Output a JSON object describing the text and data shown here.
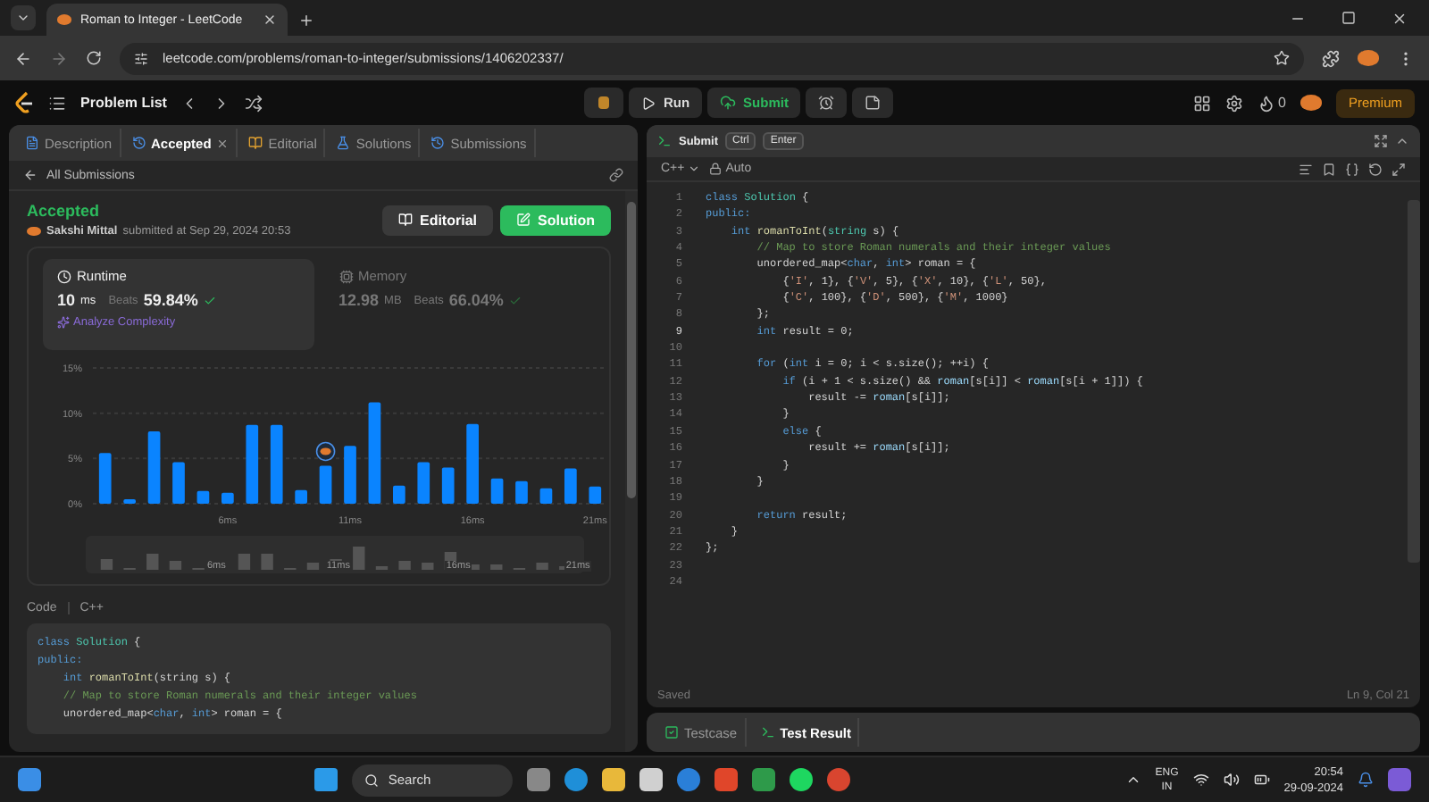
{
  "browser": {
    "tab_title": "Roman to Integer - LeetCode",
    "url": "leetcode.com/problems/roman-to-integer/submissions/1406202337/"
  },
  "topbar": {
    "problem_list": "Problem List",
    "run": "Run",
    "submit": "Submit",
    "streak": "0",
    "premium": "Premium"
  },
  "left_tabs": [
    {
      "label": "Description",
      "selected": false,
      "kind": "description"
    },
    {
      "label": "Accepted",
      "selected": true,
      "kind": "accepted"
    },
    {
      "label": "Editorial",
      "selected": false,
      "kind": "editorial"
    },
    {
      "label": "Solutions",
      "selected": false,
      "kind": "solutions"
    },
    {
      "label": "Submissions",
      "selected": false,
      "kind": "submissions"
    }
  ],
  "back_link": "All Submissions",
  "submission": {
    "status": "Accepted",
    "user": "Sakshi Mittal",
    "submitted": "submitted at Sep 29, 2024 20:53",
    "editorial_button": "Editorial",
    "solution_button": "Solution"
  },
  "metrics": [
    {
      "kind": "runtime",
      "title": "Runtime",
      "value": "10",
      "unit": "ms",
      "beats_label": "Beats",
      "beats": "59.84%",
      "selected": true,
      "link": "Analyze Complexity"
    },
    {
      "kind": "memory",
      "title": "Memory",
      "value": "12.98",
      "unit": "MB",
      "beats_label": "Beats",
      "beats": "66.04%",
      "selected": false
    }
  ],
  "chart_data": {
    "type": "bar",
    "x": [
      1,
      2,
      3,
      4,
      5,
      6,
      7,
      8,
      9,
      10,
      11,
      12,
      13,
      14,
      15,
      16,
      17,
      18,
      19,
      20,
      21
    ],
    "xlim": [
      0.5,
      21.5
    ],
    "series": [
      {
        "color": "#0a84ff",
        "values": [
          5.6,
          0.5,
          8,
          4.6,
          1.4,
          1.2,
          8.7,
          8.7,
          1.5,
          4.2,
          6.4,
          11.2,
          2,
          4.6,
          4,
          8.8,
          2.8,
          2.5,
          1.7,
          3.9,
          1.9
        ]
      }
    ],
    "ylim": [
      0,
      15
    ],
    "yticks": [
      {
        "value": 0,
        "label": "0%"
      },
      {
        "value": 5,
        "label": "5%"
      },
      {
        "value": 10,
        "label": "10%"
      },
      {
        "value": 15,
        "label": "15%"
      }
    ],
    "xticks": [
      {
        "value": 6,
        "label": "6ms"
      },
      {
        "value": 11,
        "label": "11ms"
      },
      {
        "value": 16,
        "label": "16ms"
      },
      {
        "value": 21,
        "label": "21ms"
      }
    ]
  },
  "runtime_marker": {
    "level": 0.4524
  },
  "overview_labels": [
    "6ms",
    "11ms",
    "16ms",
    "21ms"
  ],
  "code_header": {
    "title": "Code",
    "language": "C++"
  },
  "left_code": [
    [
      {
        "text": "class ",
        "kind": "keyword"
      },
      {
        "text": "Solution",
        "kind": "type"
      },
      {
        "text": " {",
        "kind": "plain"
      }
    ],
    [
      {
        "text": "public:",
        "kind": "keyword"
      }
    ],
    [
      {
        "text": "    int ",
        "kind": "keyword"
      },
      {
        "text": "romanToInt",
        "kind": "function"
      },
      {
        "text": "(string s) {",
        "kind": "plain"
      }
    ],
    [
      {
        "text": "    // Map to store Roman numerals and their integer values",
        "kind": "comment"
      }
    ],
    [
      {
        "text": "    unordered_map<",
        "kind": "plain"
      },
      {
        "text": "char",
        "kind": "keyword"
      },
      {
        "text": ", ",
        "kind": "plain"
      },
      {
        "text": "int",
        "kind": "keyword"
      },
      {
        "text": "> roman = {",
        "kind": "plain"
      }
    ]
  ],
  "editor_header": {
    "submit": "Submit",
    "key1": "Ctrl",
    "key2": "Enter",
    "language": "C++",
    "mode": "Auto"
  },
  "editor_lines": [
    {
      "n": "1",
      "tokens": [
        {
          "text": "class ",
          "kind": "keyword"
        },
        {
          "text": "Solution",
          "kind": "type"
        },
        {
          "text": " {",
          "kind": "plain"
        }
      ]
    },
    {
      "n": "2",
      "tokens": [
        {
          "text": "public:",
          "kind": "keyword"
        }
      ]
    },
    {
      "n": "3",
      "tokens": [
        {
          "text": "    int ",
          "kind": "keyword"
        },
        {
          "text": "romanToInt",
          "kind": "function"
        },
        {
          "text": "(",
          "kind": "plain"
        },
        {
          "text": "string ",
          "kind": "type"
        },
        {
          "text": "s) {",
          "kind": "plain"
        }
      ]
    },
    {
      "n": "4",
      "tokens": [
        {
          "text": "        // Map to store Roman numerals and their integer values",
          "kind": "comment"
        }
      ]
    },
    {
      "n": "5",
      "tokens": [
        {
          "text": "        unordered_map<",
          "kind": "plain"
        },
        {
          "text": "char",
          "kind": "keyword"
        },
        {
          "text": ", ",
          "kind": "plain"
        },
        {
          "text": "int",
          "kind": "keyword"
        },
        {
          "text": "> roman = {",
          "kind": "plain"
        }
      ]
    },
    {
      "n": "6",
      "tokens": [
        {
          "text": "            {",
          "kind": "plain"
        },
        {
          "text": "'I'",
          "kind": "string"
        },
        {
          "text": ", 1}, {",
          "kind": "plain"
        },
        {
          "text": "'V'",
          "kind": "string"
        },
        {
          "text": ", 5}, {",
          "kind": "plain"
        },
        {
          "text": "'X'",
          "kind": "string"
        },
        {
          "text": ", 10}, {",
          "kind": "plain"
        },
        {
          "text": "'L'",
          "kind": "string"
        },
        {
          "text": ", 50},",
          "kind": "plain"
        }
      ]
    },
    {
      "n": "7",
      "tokens": [
        {
          "text": "            {",
          "kind": "plain"
        },
        {
          "text": "'C'",
          "kind": "string"
        },
        {
          "text": ", 100}, {",
          "kind": "plain"
        },
        {
          "text": "'D'",
          "kind": "string"
        },
        {
          "text": ", 500}, {",
          "kind": "plain"
        },
        {
          "text": "'M'",
          "kind": "string"
        },
        {
          "text": ", 1000}",
          "kind": "plain"
        }
      ]
    },
    {
      "n": "8",
      "tokens": [
        {
          "text": "        };",
          "kind": "plain"
        }
      ]
    },
    {
      "n": "9",
      "tokens": [
        {
          "text": "        int ",
          "kind": "keyword"
        },
        {
          "text": "result = 0;",
          "kind": "plain"
        }
      ]
    },
    {
      "n": "10"
    },
    {
      "n": "11",
      "tokens": [
        {
          "text": "        for ",
          "kind": "keyword"
        },
        {
          "text": "(",
          "kind": "plain"
        },
        {
          "text": "int ",
          "kind": "keyword"
        },
        {
          "text": "i = 0; i < s.size(); ++i) {",
          "kind": "plain"
        }
      ]
    },
    {
      "n": "12",
      "tokens": [
        {
          "text": "            if ",
          "kind": "keyword"
        },
        {
          "text": "(i + 1 < s.size() && ",
          "kind": "plain"
        },
        {
          "text": "roman",
          "kind": "variable"
        },
        {
          "text": "[s[i]] < ",
          "kind": "plain"
        },
        {
          "text": "roman",
          "kind": "variable"
        },
        {
          "text": "[s[i + 1]]) {",
          "kind": "plain"
        }
      ]
    },
    {
      "n": "13",
      "tokens": [
        {
          "text": "                result -= ",
          "kind": "plain"
        },
        {
          "text": "roman",
          "kind": "variable"
        },
        {
          "text": "[s[i]];",
          "kind": "plain"
        }
      ]
    },
    {
      "n": "14",
      "tokens": [
        {
          "text": "            }",
          "kind": "plain"
        }
      ]
    },
    {
      "n": "15",
      "tokens": [
        {
          "text": "            else ",
          "kind": "keyword"
        },
        {
          "text": "{",
          "kind": "plain"
        }
      ]
    },
    {
      "n": "16",
      "tokens": [
        {
          "text": "                result += ",
          "kind": "plain"
        },
        {
          "text": "roman",
          "kind": "variable"
        },
        {
          "text": "[s[i]];",
          "kind": "plain"
        }
      ]
    },
    {
      "n": "17",
      "tokens": [
        {
          "text": "            }",
          "kind": "plain"
        }
      ]
    },
    {
      "n": "18",
      "tokens": [
        {
          "text": "        }",
          "kind": "plain"
        }
      ]
    },
    {
      "n": "19"
    },
    {
      "n": "20",
      "tokens": [
        {
          "text": "        return ",
          "kind": "keyword"
        },
        {
          "text": "result;",
          "kind": "plain"
        }
      ]
    },
    {
      "n": "21",
      "tokens": [
        {
          "text": "    }",
          "kind": "plain"
        }
      ]
    },
    {
      "n": "22",
      "tokens": [
        {
          "text": "};",
          "kind": "plain"
        }
      ]
    },
    {
      "n": "23"
    },
    {
      "n": "24"
    }
  ],
  "editor_status": {
    "saved": "Saved",
    "position": "Ln 9, Col 21"
  },
  "bottom_tabs": [
    {
      "label": "Testcase",
      "selected": false,
      "kind": "testcase"
    },
    {
      "label": "Test Result",
      "selected": true,
      "kind": "result"
    }
  ],
  "taskbar": {
    "search": "Search",
    "lang1": "ENG",
    "lang2": "IN",
    "time": "20:54",
    "date": "29-09-2024"
  }
}
